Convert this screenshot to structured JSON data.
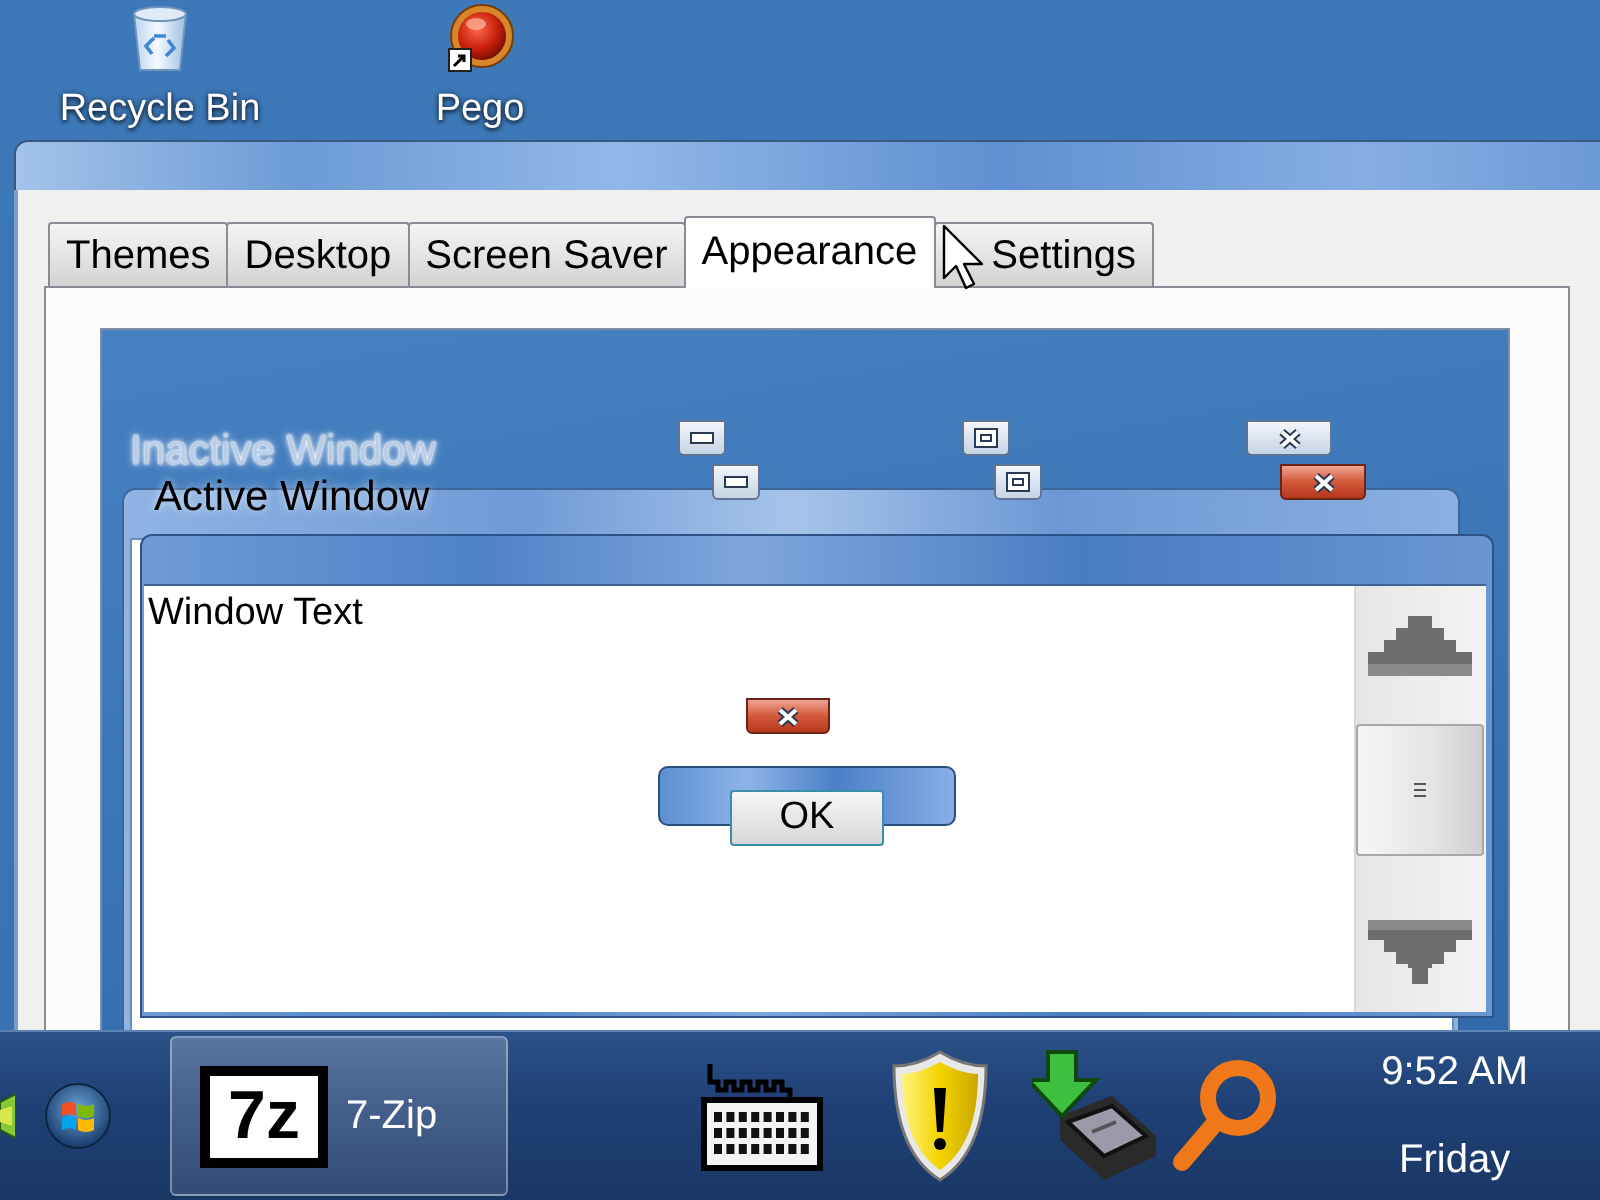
{
  "desktop_icons": [
    {
      "kind": "recycle-bin",
      "label": "Recycle Bin"
    },
    {
      "kind": "shortcut",
      "label": "Pego"
    }
  ],
  "dialog": {
    "tabs": [
      {
        "label": "Themes",
        "selected": false
      },
      {
        "label": "Desktop",
        "selected": false
      },
      {
        "label": "Screen Saver",
        "selected": false
      },
      {
        "label": "Appearance",
        "selected": true
      },
      {
        "label": "Settings",
        "selected": false
      }
    ],
    "preview": {
      "windows": [
        {
          "title": "Inactive Window",
          "active": false
        },
        {
          "title": "Active Window",
          "active": true
        }
      ],
      "window_text": "Window Text",
      "message_box": {
        "button": "OK"
      }
    }
  },
  "taskbar": {
    "buttons": [
      {
        "label": "7-Zip",
        "logo_text": "7z",
        "selected": true
      }
    ],
    "clock": {
      "time": "9:52 AM",
      "day": "Friday"
    }
  }
}
